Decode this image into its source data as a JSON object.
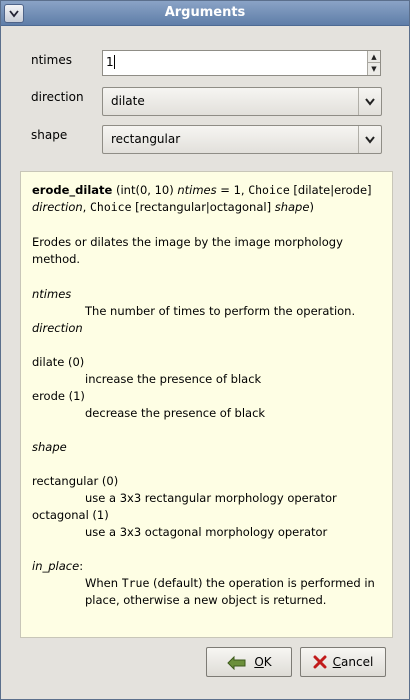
{
  "window": {
    "title": "Arguments"
  },
  "fields": {
    "ntimes": {
      "label": "ntimes",
      "value": "1"
    },
    "direction": {
      "label": "direction",
      "value": "dilate"
    },
    "shape": {
      "label": "shape",
      "value": "rectangular"
    }
  },
  "doc": {
    "sig_name": "erode_dilate",
    "sig_rest1": " (int(0, 10) ",
    "sig_ntimes": "ntimes",
    "sig_rest2": " = 1, ",
    "sig_choice1": "Choice",
    "sig_rest3": " [dilate|erode]",
    "sig_direction": "direction",
    "sig_rest4": ", ",
    "sig_choice2": "Choice",
    "sig_rest5": " [rectangular|octagonal] ",
    "sig_shape": "shape",
    "sig_rest6": ")",
    "desc": "Erodes or dilates the image by the image morphology method.",
    "ntimes_term": "ntimes",
    "ntimes_def": "The number of times to perform the operation.",
    "direction_term": "direction",
    "dilate_term": "dilate (0)",
    "dilate_def": "increase the presence of black",
    "erode_term": "erode (1)",
    "erode_def": "decrease the presence of black",
    "shape_term": "shape",
    "rect_term": "rectangular (0)",
    "rect_def": "use a 3x3 rectangular morphology operator",
    "oct_term": "octagonal (1)",
    "oct_def": "use a 3x3 octagonal morphology operator",
    "inplace_term": "in_place",
    "inplace_colon": ":",
    "inplace_def1": "When ",
    "inplace_true": "True",
    "inplace_def2": " (default) the operation is performed in place, otherwise a new object is returned."
  },
  "buttons": {
    "ok_label": "K",
    "ok_mnemonic": "O",
    "cancel_label": "ancel",
    "cancel_mnemonic": "C"
  }
}
